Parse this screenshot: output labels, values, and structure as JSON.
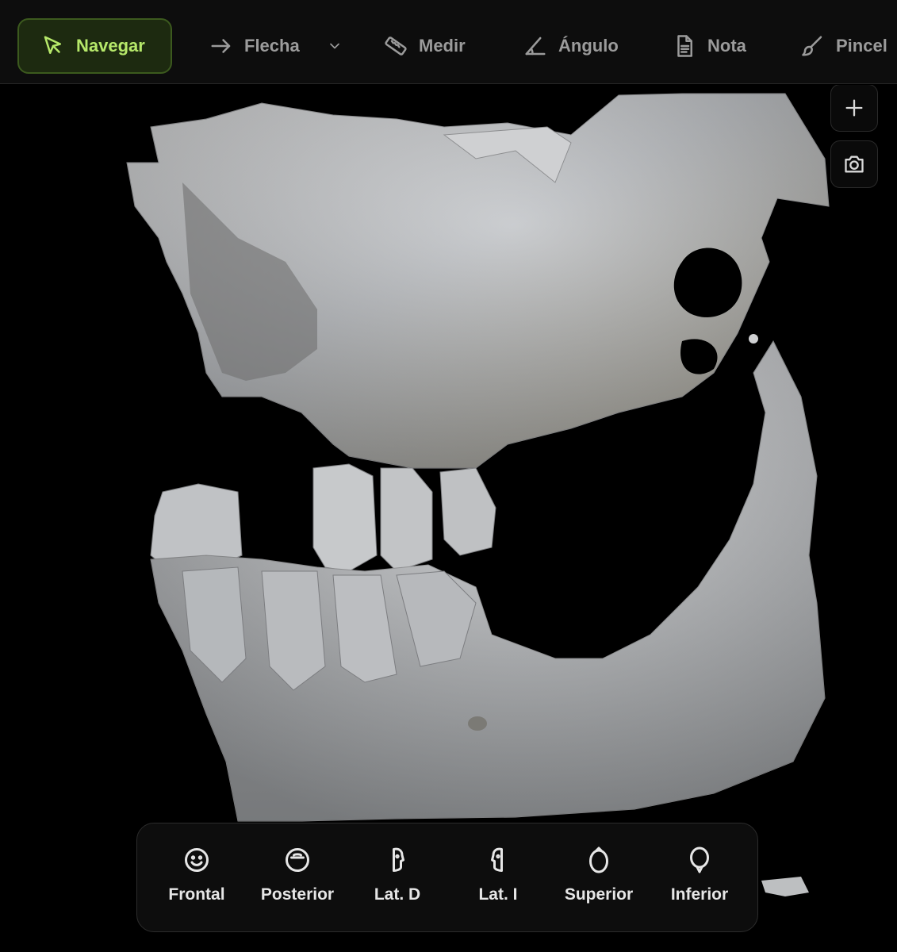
{
  "toolbar": {
    "tools": [
      {
        "label": "Navegar",
        "icon": "cursor-arrow-icon",
        "active": true
      },
      {
        "label": "Flecha",
        "icon": "arrow-right-icon"
      },
      {
        "label": "Medir",
        "icon": "ruler-icon"
      },
      {
        "label": "Ángulo",
        "icon": "angle-icon"
      },
      {
        "label": "Nota",
        "icon": "note-icon"
      },
      {
        "label": "Pincel",
        "icon": "brush-icon"
      }
    ],
    "accent": "#b6e86a"
  },
  "viewport": {
    "side_buttons": [
      {
        "icon": "plus-icon"
      },
      {
        "icon": "camera-icon"
      }
    ]
  },
  "views": [
    {
      "label": "Frontal",
      "icon": "face-front-icon"
    },
    {
      "label": "Posterior",
      "icon": "head-back-icon"
    },
    {
      "label": "Lat. D",
      "icon": "head-right-icon"
    },
    {
      "label": "Lat. I",
      "icon": "head-left-icon"
    },
    {
      "label": "Superior",
      "icon": "head-top-icon"
    },
    {
      "label": "Inferior",
      "icon": "head-bottom-icon"
    }
  ]
}
